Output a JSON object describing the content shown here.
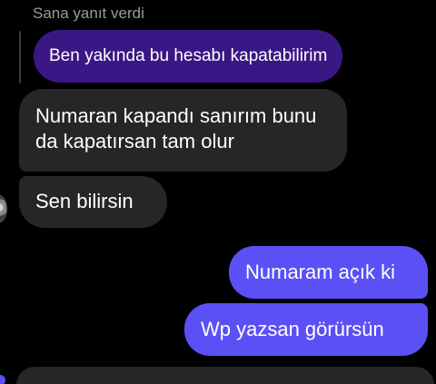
{
  "reply": {
    "header": "Sana yanıt verdi",
    "quoted_text": "Ben yakında bu hesabı kapatabilirim"
  },
  "messages": [
    {
      "direction": "incoming",
      "lines": [
        "Numaran kapandı sanırım bunu",
        "da kapatırsan tam olur"
      ]
    },
    {
      "direction": "incoming",
      "lines": [
        "Sen bilirsin"
      ]
    },
    {
      "direction": "outgoing",
      "lines": [
        "Numaram açık ki"
      ]
    },
    {
      "direction": "outgoing",
      "lines": [
        "Wp yazsan görürsün"
      ]
    }
  ],
  "colors": {
    "background": "#000000",
    "incoming_bubble": "#262626",
    "outgoing_bubble": "#5b50f5",
    "quoted_bubble": "#3b1785",
    "muted_text": "#9a9a9a"
  }
}
